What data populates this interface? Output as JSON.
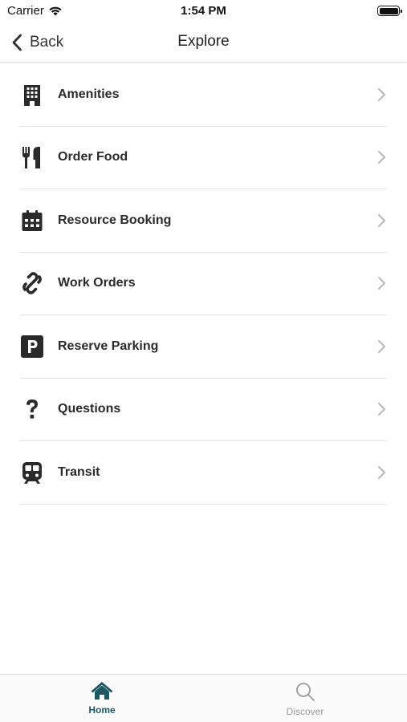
{
  "status_bar": {
    "carrier": "Carrier",
    "time": "1:54 PM"
  },
  "nav": {
    "back_label": "Back",
    "title": "Explore"
  },
  "menu": {
    "items": [
      {
        "label": "Amenities",
        "icon": "building-icon"
      },
      {
        "label": "Order Food",
        "icon": "utensils-icon"
      },
      {
        "label": "Resource Booking",
        "icon": "calendar-icon"
      },
      {
        "label": "Work Orders",
        "icon": "link-icon"
      },
      {
        "label": "Reserve Parking",
        "icon": "parking-icon"
      },
      {
        "label": "Questions",
        "icon": "question-icon"
      },
      {
        "label": "Transit",
        "icon": "train-icon"
      }
    ]
  },
  "tab_bar": {
    "tabs": [
      {
        "label": "Home",
        "icon": "home-icon",
        "active": true
      },
      {
        "label": "Discover",
        "icon": "search-icon",
        "active": false
      }
    ]
  },
  "colors": {
    "accent": "#1c5a63",
    "icon": "#2a2a2a",
    "chevron": "#b8b8b8",
    "inactive_tab": "#9a9a9a"
  }
}
